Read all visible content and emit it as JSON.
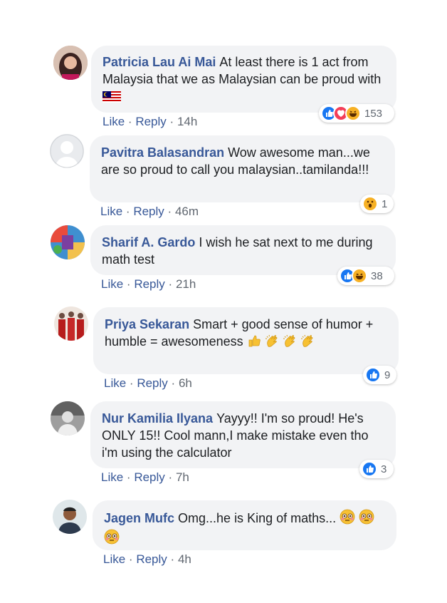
{
  "colors": {
    "author": "#385898",
    "bubble": "#f2f3f5",
    "meta": "#606770",
    "like": "#1877f2",
    "love": "#f33e58",
    "haha": "#f7b125"
  },
  "actions": {
    "like": "Like",
    "reply": "Reply",
    "sep": "·"
  },
  "comments": [
    {
      "author": "Patricia Lau Ai Mai",
      "text": "At least there is 1 act from Malaysia that we as Malaysian can be proud with",
      "emoji": [
        "flag-malaysia"
      ],
      "time": "14h",
      "reactions": [
        "like",
        "love",
        "haha"
      ],
      "count": "153",
      "avatar": "photo-woman-pink"
    },
    {
      "author": "Pavitra Balasandran",
      "text": "Wow awesome man...we are so proud to call you malaysian..tamilanda!!!",
      "emoji": [],
      "time": "46m",
      "reactions": [
        "wow"
      ],
      "count": "1",
      "avatar": "default-silhouette"
    },
    {
      "author": "Sharif A. Gardo",
      "text": "I wish he sat next to me during math test",
      "emoji": [],
      "time": "21h",
      "reactions": [
        "like",
        "haha"
      ],
      "count": "38",
      "avatar": "photo-colorful"
    },
    {
      "author": "Priya Sekaran",
      "text": "Smart + good sense of humor + humble = awesomeness",
      "emoji": [
        "thumbs-up",
        "clap",
        "clap",
        "clap"
      ],
      "time": "6h",
      "reactions": [
        "like"
      ],
      "count": "9",
      "avatar": "photo-group-red"
    },
    {
      "author": "Nur Kamilia Ilyana",
      "text": "Yayyy!! I'm so proud! He's ONLY 15!! Cool mann,I make mistake even tho i'm using the calculator",
      "emoji": [],
      "time": "7h",
      "reactions": [
        "like"
      ],
      "count": "3",
      "avatar": "photo-grey"
    },
    {
      "author": "Jagen Mufc",
      "text": "Omg...he is King of maths...",
      "emoji": [
        "flushed",
        "flushed",
        "flushed"
      ],
      "time": "4h",
      "reactions": [],
      "count": "",
      "avatar": "photo-man"
    }
  ]
}
